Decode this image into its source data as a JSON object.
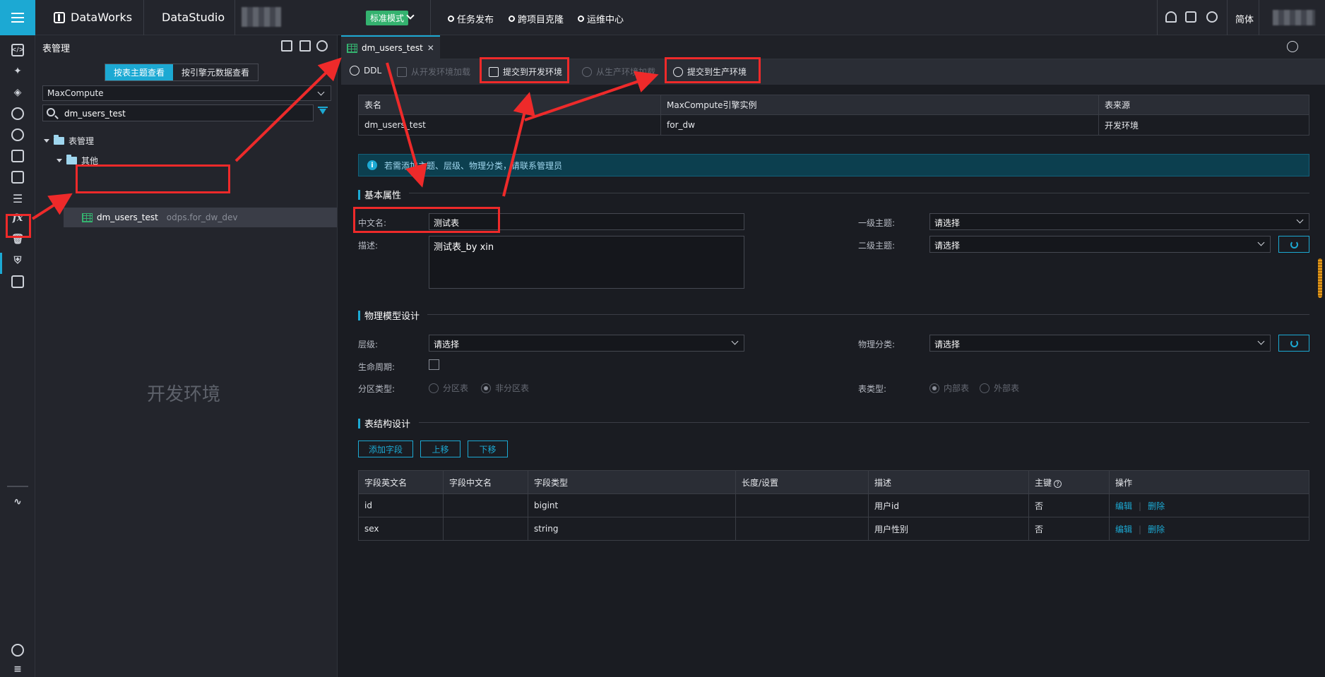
{
  "topbar": {
    "brand": "DataWorks",
    "app": "DataStudio",
    "mode": "标准模式",
    "links": [
      "任务发布",
      "跨项目克隆",
      "运维中心"
    ],
    "lang": "简体"
  },
  "panel": {
    "title": "表管理",
    "view_tabs": [
      "按表主题查看",
      "按引擎元数据查看"
    ],
    "engine": "MaxCompute",
    "search_value": "dm_users_test",
    "tree": {
      "root": "表管理",
      "child": "其他",
      "table_name": "dm_users_test",
      "table_source": "odps.for_dw_dev"
    },
    "watermark": "开发环境"
  },
  "editor": {
    "tab_label": "dm_users_test",
    "toolbar": {
      "ddl": "DDL",
      "load_from_dev": "从开发环境加载",
      "submit_dev": "提交到开发环境",
      "load_from_prod": "从生产环境加载",
      "submit_prod": "提交到生产环境"
    },
    "info_table": {
      "headers": [
        "表名",
        "MaxCompute引擎实例",
        "表来源"
      ],
      "row": [
        "dm_users_test",
        "for_dw",
        "开发环境"
      ]
    },
    "notice": "若需添加主题、层级、物理分类，请联系管理员",
    "basic": {
      "title": "基本属性",
      "cn_name_label": "中文名:",
      "cn_name_value": "测试表",
      "desc_label": "描述:",
      "desc_value": "测试表_by xin",
      "topic1_label": "一级主题:",
      "topic1_value": "请选择",
      "topic2_label": "二级主题:",
      "topic2_value": "请选择"
    },
    "physical": {
      "title": "物理模型设计",
      "level_label": "层级:",
      "level_value": "请选择",
      "phys_class_label": "物理分类:",
      "phys_class_value": "请选择",
      "lifecycle_label": "生命周期:",
      "partition_label": "分区类型:",
      "partition_opt1": "分区表",
      "partition_opt2": "非分区表",
      "table_type_label": "表类型:",
      "table_type_opt1": "内部表",
      "table_type_opt2": "外部表"
    },
    "structure": {
      "title": "表结构设计",
      "add_field": "添加字段",
      "move_up": "上移",
      "move_down": "下移",
      "headers": [
        "字段英文名",
        "字段中文名",
        "字段类型",
        "长度/设置",
        "描述",
        "主键",
        "操作"
      ],
      "rows": [
        {
          "en": "id",
          "cn": "",
          "type": "bigint",
          "len": "",
          "desc": "用户id",
          "pk": "否",
          "edit": "编辑",
          "del": "删除"
        },
        {
          "en": "sex",
          "cn": "",
          "type": "string",
          "len": "",
          "desc": "用户性别",
          "pk": "否",
          "edit": "编辑",
          "del": "删除"
        }
      ]
    }
  },
  "colors": {
    "accent": "#1ca9d3",
    "annotation": "#ee2a2a",
    "mode_badge": "#34b26f"
  }
}
